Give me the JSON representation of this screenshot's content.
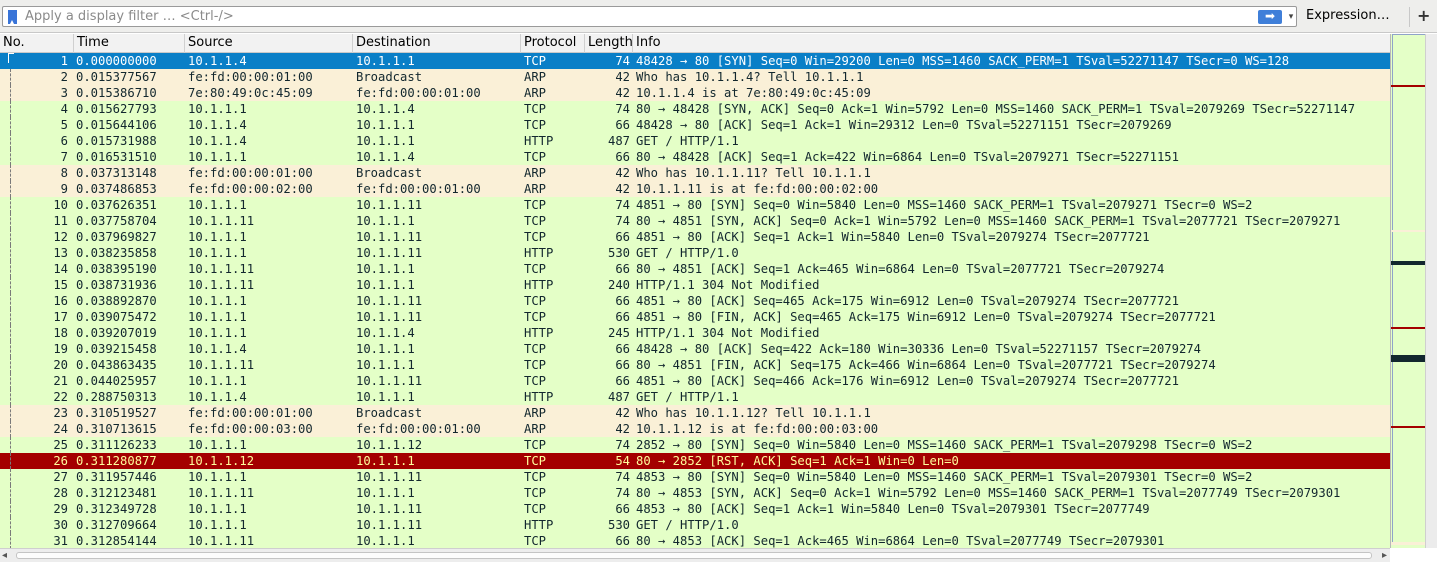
{
  "filter": {
    "placeholder": "Apply a display filter … <Ctrl-/>",
    "apply_icon": "arrow-right-icon",
    "expression_label": "Expression…",
    "add_label": "+"
  },
  "columns": [
    "No.",
    "Time",
    "Source",
    "Destination",
    "Protocol",
    "Length",
    "Info"
  ],
  "colors": {
    "tcp_http": "#e4ffc7",
    "arp": "#faf0d7",
    "selected": "#0a7fc7",
    "rst": "#a40000",
    "rst_text": "#fffc9c"
  },
  "packets": [
    {
      "no": "1",
      "time": "0.000000000",
      "src": "10.1.1.4",
      "dst": "10.1.1.1",
      "proto": "TCP",
      "len": "74",
      "info": "48428 → 80 [SYN] Seq=0 Win=29200 Len=0 MSS=1460 SACK_PERM=1 TSval=52271147 TSecr=0 WS=128",
      "style": "selected"
    },
    {
      "no": "2",
      "time": "0.015377567",
      "src": "fe:fd:00:00:01:00",
      "dst": "Broadcast",
      "proto": "ARP",
      "len": "42",
      "info": "Who has 10.1.1.4? Tell 10.1.1.1",
      "style": "arp"
    },
    {
      "no": "3",
      "time": "0.015386710",
      "src": "7e:80:49:0c:45:09",
      "dst": "fe:fd:00:00:01:00",
      "proto": "ARP",
      "len": "42",
      "info": "10.1.1.4 is at 7e:80:49:0c:45:09",
      "style": "arp"
    },
    {
      "no": "4",
      "time": "0.015627793",
      "src": "10.1.1.1",
      "dst": "10.1.1.4",
      "proto": "TCP",
      "len": "74",
      "info": "80 → 48428 [SYN, ACK] Seq=0 Ack=1 Win=5792 Len=0 MSS=1460 SACK_PERM=1 TSval=2079269 TSecr=52271147",
      "style": "green"
    },
    {
      "no": "5",
      "time": "0.015644106",
      "src": "10.1.1.4",
      "dst": "10.1.1.1",
      "proto": "TCP",
      "len": "66",
      "info": "48428 → 80 [ACK] Seq=1 Ack=1 Win=29312 Len=0 TSval=52271151 TSecr=2079269",
      "style": "green"
    },
    {
      "no": "6",
      "time": "0.015731988",
      "src": "10.1.1.4",
      "dst": "10.1.1.1",
      "proto": "HTTP",
      "len": "487",
      "info": "GET / HTTP/1.1",
      "style": "green"
    },
    {
      "no": "7",
      "time": "0.016531510",
      "src": "10.1.1.1",
      "dst": "10.1.1.4",
      "proto": "TCP",
      "len": "66",
      "info": "80 → 48428 [ACK] Seq=1 Ack=422 Win=6864 Len=0 TSval=2079271 TSecr=52271151",
      "style": "green"
    },
    {
      "no": "8",
      "time": "0.037313148",
      "src": "fe:fd:00:00:01:00",
      "dst": "Broadcast",
      "proto": "ARP",
      "len": "42",
      "info": "Who has 10.1.1.11? Tell 10.1.1.1",
      "style": "arp"
    },
    {
      "no": "9",
      "time": "0.037486853",
      "src": "fe:fd:00:00:02:00",
      "dst": "fe:fd:00:00:01:00",
      "proto": "ARP",
      "len": "42",
      "info": "10.1.1.11 is at fe:fd:00:00:02:00",
      "style": "arp"
    },
    {
      "no": "10",
      "time": "0.037626351",
      "src": "10.1.1.1",
      "dst": "10.1.1.11",
      "proto": "TCP",
      "len": "74",
      "info": "4851 → 80 [SYN] Seq=0 Win=5840 Len=0 MSS=1460 SACK_PERM=1 TSval=2079271 TSecr=0 WS=2",
      "style": "green"
    },
    {
      "no": "11",
      "time": "0.037758704",
      "src": "10.1.1.11",
      "dst": "10.1.1.1",
      "proto": "TCP",
      "len": "74",
      "info": "80 → 4851 [SYN, ACK] Seq=0 Ack=1 Win=5792 Len=0 MSS=1460 SACK_PERM=1 TSval=2077721 TSecr=2079271",
      "style": "green"
    },
    {
      "no": "12",
      "time": "0.037969827",
      "src": "10.1.1.1",
      "dst": "10.1.1.11",
      "proto": "TCP",
      "len": "66",
      "info": "4851 → 80 [ACK] Seq=1 Ack=1 Win=5840 Len=0 TSval=2079274 TSecr=2077721",
      "style": "green"
    },
    {
      "no": "13",
      "time": "0.038235858",
      "src": "10.1.1.1",
      "dst": "10.1.1.11",
      "proto": "HTTP",
      "len": "530",
      "info": "GET / HTTP/1.0",
      "style": "green"
    },
    {
      "no": "14",
      "time": "0.038395190",
      "src": "10.1.1.11",
      "dst": "10.1.1.1",
      "proto": "TCP",
      "len": "66",
      "info": "80 → 4851 [ACK] Seq=1 Ack=465 Win=6864 Len=0 TSval=2077721 TSecr=2079274",
      "style": "green"
    },
    {
      "no": "15",
      "time": "0.038731936",
      "src": "10.1.1.11",
      "dst": "10.1.1.1",
      "proto": "HTTP",
      "len": "240",
      "info": "HTTP/1.1 304 Not Modified",
      "style": "green"
    },
    {
      "no": "16",
      "time": "0.038892870",
      "src": "10.1.1.1",
      "dst": "10.1.1.11",
      "proto": "TCP",
      "len": "66",
      "info": "4851 → 80 [ACK] Seq=465 Ack=175 Win=6912 Len=0 TSval=2079274 TSecr=2077721",
      "style": "green"
    },
    {
      "no": "17",
      "time": "0.039075472",
      "src": "10.1.1.1",
      "dst": "10.1.1.11",
      "proto": "TCP",
      "len": "66",
      "info": "4851 → 80 [FIN, ACK] Seq=465 Ack=175 Win=6912 Len=0 TSval=2079274 TSecr=2077721",
      "style": "green"
    },
    {
      "no": "18",
      "time": "0.039207019",
      "src": "10.1.1.1",
      "dst": "10.1.1.4",
      "proto": "HTTP",
      "len": "245",
      "info": "HTTP/1.1 304 Not Modified",
      "style": "green"
    },
    {
      "no": "19",
      "time": "0.039215458",
      "src": "10.1.1.4",
      "dst": "10.1.1.1",
      "proto": "TCP",
      "len": "66",
      "info": "48428 → 80 [ACK] Seq=422 Ack=180 Win=30336 Len=0 TSval=52271157 TSecr=2079274",
      "style": "green"
    },
    {
      "no": "20",
      "time": "0.043863435",
      "src": "10.1.1.11",
      "dst": "10.1.1.1",
      "proto": "TCP",
      "len": "66",
      "info": "80 → 4851 [FIN, ACK] Seq=175 Ack=466 Win=6864 Len=0 TSval=2077721 TSecr=2079274",
      "style": "green"
    },
    {
      "no": "21",
      "time": "0.044025957",
      "src": "10.1.1.1",
      "dst": "10.1.1.11",
      "proto": "TCP",
      "len": "66",
      "info": "4851 → 80 [ACK] Seq=466 Ack=176 Win=6912 Len=0 TSval=2079274 TSecr=2077721",
      "style": "green"
    },
    {
      "no": "22",
      "time": "0.288750313",
      "src": "10.1.1.4",
      "dst": "10.1.1.1",
      "proto": "HTTP",
      "len": "487",
      "info": "GET / HTTP/1.1",
      "style": "green"
    },
    {
      "no": "23",
      "time": "0.310519527",
      "src": "fe:fd:00:00:01:00",
      "dst": "Broadcast",
      "proto": "ARP",
      "len": "42",
      "info": "Who has 10.1.1.12? Tell 10.1.1.1",
      "style": "arp"
    },
    {
      "no": "24",
      "time": "0.310713615",
      "src": "fe:fd:00:00:03:00",
      "dst": "fe:fd:00:00:01:00",
      "proto": "ARP",
      "len": "42",
      "info": "10.1.1.12 is at fe:fd:00:00:03:00",
      "style": "arp"
    },
    {
      "no": "25",
      "time": "0.311126233",
      "src": "10.1.1.1",
      "dst": "10.1.1.12",
      "proto": "TCP",
      "len": "74",
      "info": "2852 → 80 [SYN] Seq=0 Win=5840 Len=0 MSS=1460 SACK_PERM=1 TSval=2079298 TSecr=0 WS=2",
      "style": "green"
    },
    {
      "no": "26",
      "time": "0.311280877",
      "src": "10.1.1.12",
      "dst": "10.1.1.1",
      "proto": "TCP",
      "len": "54",
      "info": "80 → 2852 [RST, ACK] Seq=1 Ack=1 Win=0 Len=0",
      "style": "rst"
    },
    {
      "no": "27",
      "time": "0.311957446",
      "src": "10.1.1.1",
      "dst": "10.1.1.11",
      "proto": "TCP",
      "len": "74",
      "info": "4853 → 80 [SYN] Seq=0 Win=5840 Len=0 MSS=1460 SACK_PERM=1 TSval=2079301 TSecr=0 WS=2",
      "style": "green"
    },
    {
      "no": "28",
      "time": "0.312123481",
      "src": "10.1.1.11",
      "dst": "10.1.1.1",
      "proto": "TCP",
      "len": "74",
      "info": "80 → 4853 [SYN, ACK] Seq=0 Ack=1 Win=5792 Len=0 MSS=1460 SACK_PERM=1 TSval=2077749 TSecr=2079301",
      "style": "green"
    },
    {
      "no": "29",
      "time": "0.312349728",
      "src": "10.1.1.1",
      "dst": "10.1.1.11",
      "proto": "TCP",
      "len": "66",
      "info": "4853 → 80 [ACK] Seq=1 Ack=1 Win=5840 Len=0 TSval=2079301 TSecr=2077749",
      "style": "green"
    },
    {
      "no": "30",
      "time": "0.312709664",
      "src": "10.1.1.1",
      "dst": "10.1.1.11",
      "proto": "HTTP",
      "len": "530",
      "info": "GET / HTTP/1.0",
      "style": "green"
    },
    {
      "no": "31",
      "time": "0.312854144",
      "src": "10.1.1.11",
      "dst": "10.1.1.1",
      "proto": "TCP",
      "len": "66",
      "info": "80 → 4853 [ACK] Seq=1 Ack=465 Win=6864 Len=0 TSval=2077749 TSecr=2079301",
      "style": "green"
    }
  ]
}
